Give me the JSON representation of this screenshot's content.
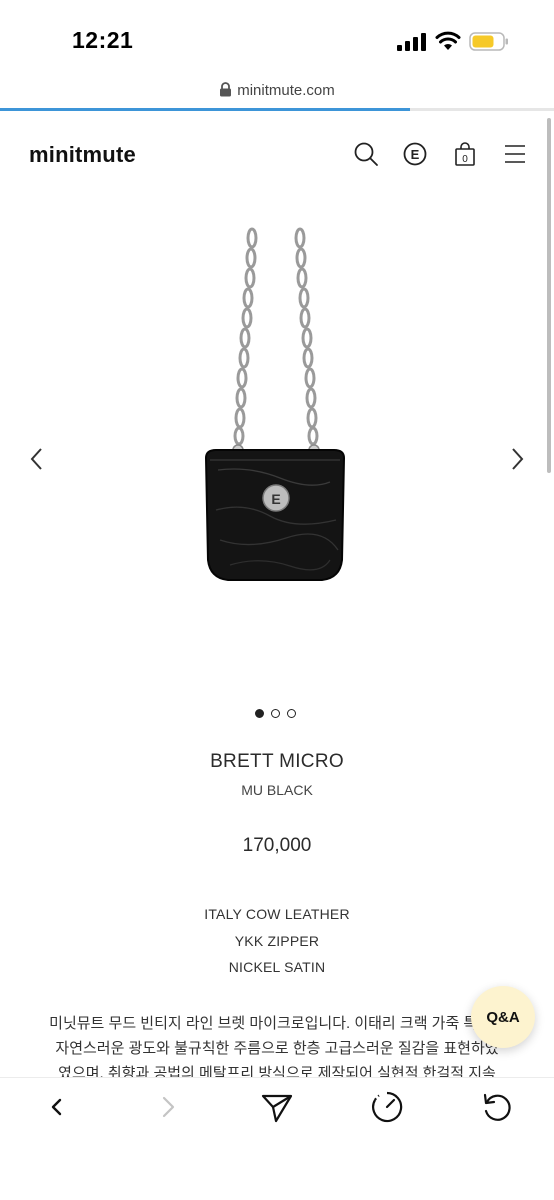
{
  "status_bar": {
    "time": "12:21"
  },
  "browser": {
    "url": "minitmute.com",
    "load_progress": 0.74
  },
  "header": {
    "logo": "minitmute",
    "bag_count": "0",
    "brand_mark": "E"
  },
  "gallery": {
    "image_alt": "black crinkled leather micro bag with silver chain strap",
    "badge_letter": "E",
    "slide_count": 3,
    "active_slide": 1
  },
  "product": {
    "name": "BRETT MICRO",
    "color": "MU BLACK",
    "price": "170,000",
    "specs": [
      "ITALY COW LEATHER",
      "YKK ZIPPER",
      "NICKEL SATIN"
    ],
    "description_lines": [
      "미닛뮤트 무드 빈티지 라인 브렛 마이크로입니다. 이태리 크랙 가죽 특유의",
      "자연스러운 광도와 불규칙한 주름으로 한층 고급스러운 질감을 표현하였",
      "였으며, 취향과 공법의 메탈프리 방식으로 제작되어 실현적 한걸적 지속"
    ]
  },
  "qa_button": {
    "label": "Q&A"
  },
  "colors": {
    "accent": "#3d95d8",
    "qa_bg": "#fdf3cf",
    "text": "#2b2b2b"
  },
  "icons": {
    "header": [
      "search-icon",
      "brand-icon",
      "bag-icon",
      "menu-icon"
    ],
    "toolbar": [
      "back-icon",
      "forward-icon",
      "share-icon",
      "speed-icon",
      "reload-icon"
    ]
  }
}
